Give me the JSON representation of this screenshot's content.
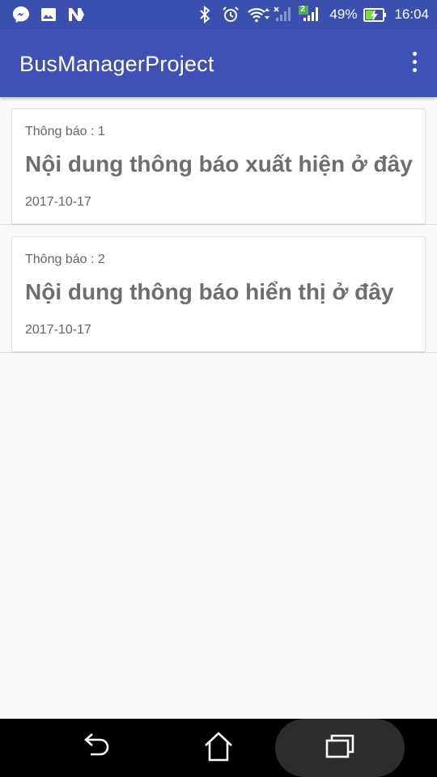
{
  "status_bar": {
    "battery_percent": "49%",
    "time": "16:04",
    "sim_badge": "2",
    "left_icons": [
      "messenger-icon",
      "gallery-icon",
      "n-app-icon"
    ],
    "right_icons": [
      "bluetooth-icon",
      "alarm-icon",
      "wifi-icon",
      "signal-icon",
      "battery-charging-icon"
    ]
  },
  "toolbar": {
    "title": "BusManagerProject",
    "menu_icon": "more-vert-icon",
    "color": "#3f51b5"
  },
  "notifications": [
    {
      "label": "Thông báo : 1",
      "content": "Nội dung thông báo xuất hiện ở đây",
      "date": "2017-10-17"
    },
    {
      "label": "Thông báo : 2",
      "content": "Nội dung thông báo hiển thị ở đây",
      "date": "2017-10-17"
    }
  ],
  "nav_bar": {
    "icons": [
      "back-icon",
      "home-icon",
      "recents-icon"
    ]
  }
}
